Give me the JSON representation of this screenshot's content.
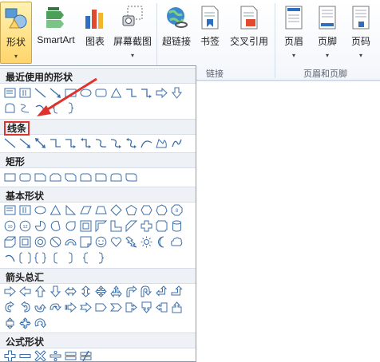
{
  "ribbon": {
    "buttons": [
      {
        "label": "形状",
        "icon": "shapes-icon",
        "caret": "▾",
        "name": "shapes-button"
      },
      {
        "label": "SmartArt",
        "icon": "smartart-icon",
        "caret": "",
        "name": "smartart-button"
      },
      {
        "label": "图表",
        "icon": "chart-icon",
        "caret": "",
        "name": "chart-button"
      },
      {
        "label": "屏幕截图",
        "icon": "screenshot-icon",
        "caret": "▾",
        "name": "screenshot-button"
      },
      {
        "label": "超链接",
        "icon": "hyperlink-icon",
        "caret": "",
        "name": "hyperlink-button"
      },
      {
        "label": "书签",
        "icon": "bookmark-icon",
        "caret": "",
        "name": "bookmark-button"
      },
      {
        "label": "交叉引用",
        "icon": "cross-reference-icon",
        "caret": "",
        "name": "cross-reference-button"
      },
      {
        "label": "页眉",
        "icon": "header-icon",
        "caret": "▾",
        "name": "header-button"
      },
      {
        "label": "页脚",
        "icon": "footer-icon",
        "caret": "▾",
        "name": "footer-button"
      },
      {
        "label": "页码",
        "icon": "page-number-icon",
        "caret": "▾",
        "name": "page-number-button"
      }
    ],
    "groups": {
      "links": "链接",
      "header_footer": "页眉和页脚"
    }
  },
  "gallery": {
    "sections": [
      {
        "title": "最近使用的形状",
        "name": "recent-shapes"
      },
      {
        "title": "线条",
        "name": "lines",
        "highlighted": true
      },
      {
        "title": "矩形",
        "name": "rectangles"
      },
      {
        "title": "基本形状",
        "name": "basic-shapes"
      },
      {
        "title": "箭头总汇",
        "name": "block-arrows"
      },
      {
        "title": "公式形状",
        "name": "equation-shapes"
      }
    ]
  },
  "annotation": {
    "color": "#e0322c"
  },
  "colors": {
    "accent": "#ffd56b",
    "highlight_border": "#e0322c",
    "section_bg": "#eef1f6"
  }
}
